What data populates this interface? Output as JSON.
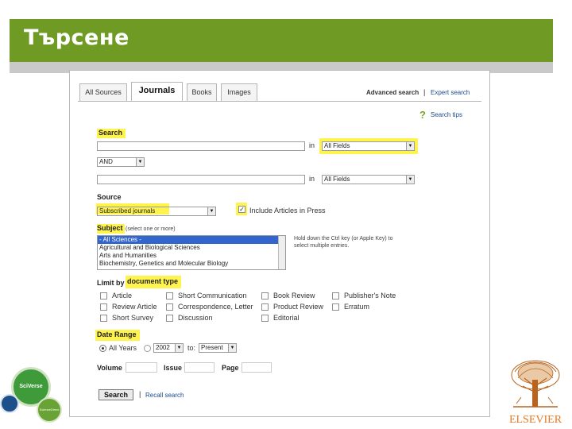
{
  "slide": {
    "title": "Търсене"
  },
  "tabs": [
    "All Sources",
    "Journals",
    "Books",
    "Images"
  ],
  "top_links": {
    "advanced": "Advanced search",
    "separator": "|",
    "expert": "Expert search"
  },
  "help": {
    "icon": "?",
    "label": "Search tips"
  },
  "search": {
    "label": "Search",
    "in_label": "in",
    "field1": "All Fields",
    "operator": "AND",
    "field2": "All Fields"
  },
  "source": {
    "label": "Source",
    "value": "Subscribed journals",
    "include_label": "Include Articles in Press"
  },
  "subject": {
    "label": "Subject",
    "hint": "(select one or more)",
    "items": [
      "- All Sciences -",
      "Agricultural and Biological Sciences",
      "Arts and Humanities",
      "Biochemistry, Genetics and Molecular Biology"
    ],
    "note": "Hold down the Ctrl key (or Apple Key) to select multiple entries."
  },
  "doctype": {
    "label_prefix": "Limit by",
    "label_hl": "document type",
    "options": [
      [
        "Article",
        "Short Communication",
        "Book Review",
        "Publisher's Note"
      ],
      [
        "Review Article",
        "Correspondence, Letter",
        "Product Review",
        "Erratum"
      ],
      [
        "Short Survey",
        "Discussion",
        "Editorial"
      ]
    ]
  },
  "date": {
    "label": "Date Range",
    "all_years": "All Years",
    "from_year": "2002",
    "to_label": "to:",
    "to_value": "Present"
  },
  "volume": {
    "label": "Volume",
    "issue": "Issue",
    "page": "Page"
  },
  "actions": {
    "search": "Search",
    "separator": "|",
    "recall": "Recall search"
  },
  "logos": {
    "sciverse": "SciVerse",
    "sciencedirect": "ScienceDirect",
    "elsevier": "ELSEVIER"
  },
  "colors": {
    "banner": "#6f9a24",
    "highlight": "#fff34d",
    "link": "#1a4a8c"
  }
}
